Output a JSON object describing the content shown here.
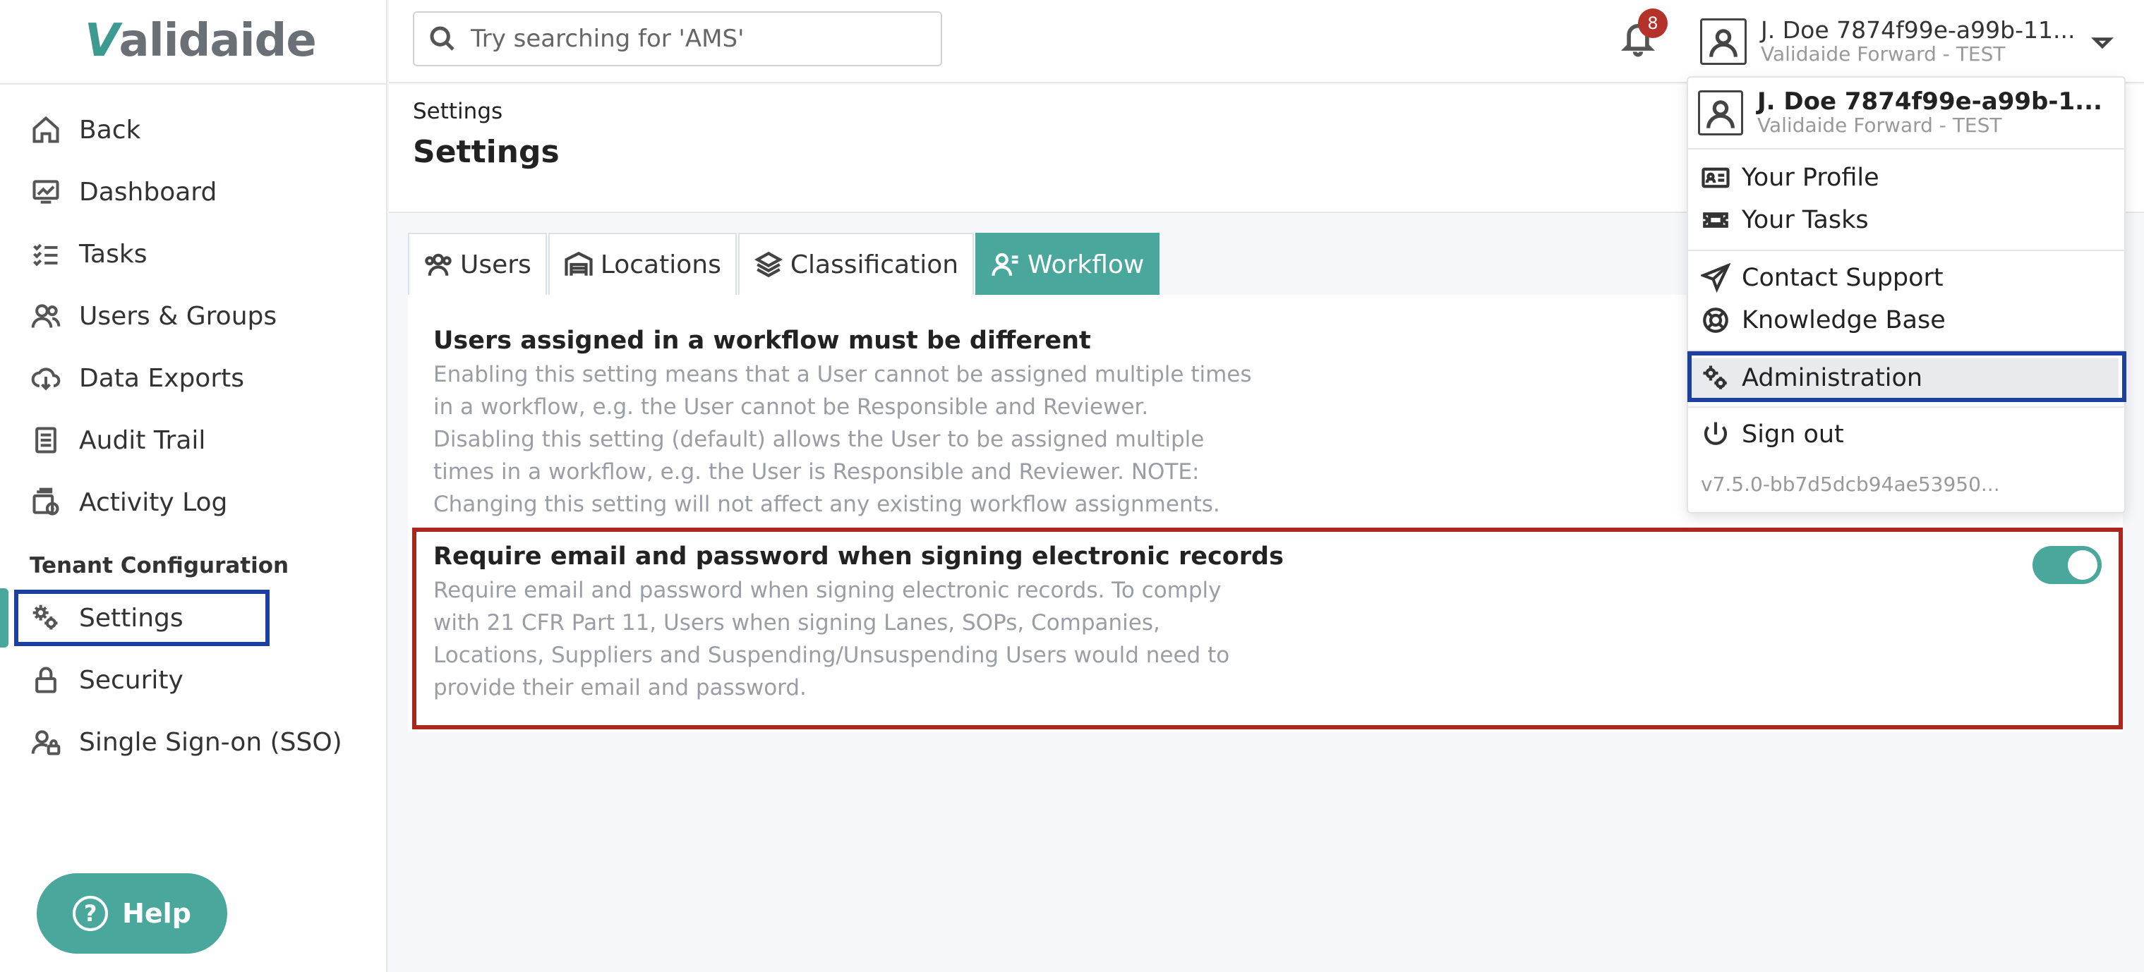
{
  "app": {
    "logo_v": "V",
    "logo_rest": "alidaide"
  },
  "sidebar": {
    "items": [
      {
        "label": "Back"
      },
      {
        "label": "Dashboard"
      },
      {
        "label": "Tasks"
      },
      {
        "label": "Users & Groups"
      },
      {
        "label": "Data Exports"
      },
      {
        "label": "Audit Trail"
      },
      {
        "label": "Activity Log"
      }
    ],
    "section_label": "Tenant Configuration",
    "config_items": [
      {
        "label": "Settings"
      },
      {
        "label": "Security"
      },
      {
        "label": "Single Sign-on (SSO)"
      }
    ],
    "help_label": "Help"
  },
  "topbar": {
    "search_placeholder": "Try searching for 'AMS'",
    "notification_count": "8",
    "user_name": "J. Doe 7874f99e-a99b-11...",
    "user_org": "Validaide Forward - TEST"
  },
  "header": {
    "breadcrumb": "Settings",
    "title": "Settings"
  },
  "tabs": [
    {
      "label": "Users"
    },
    {
      "label": "Locations"
    },
    {
      "label": "Classification"
    },
    {
      "label": "Workflow"
    }
  ],
  "settings": [
    {
      "title": "Users assigned in a workflow must be different",
      "description": "Enabling this setting means that a User cannot be assigned multiple times in a workflow, e.g. the User cannot be Responsible and Reviewer. Disabling this setting (default) allows the User to be assigned multiple times in a workflow, e.g. the User is Responsible and Reviewer. NOTE: Changing this setting will not affect any existing workflow assignments."
    },
    {
      "title": "Require email and password when signing electronic records",
      "description": "Require email and password when signing electronic records. To comply with 21 CFR Part 11, Users when signing Lanes, SOPs, Companies, Locations, Suppliers and Suspending/Unsuspending Users would need to provide their email and password.",
      "enabled": true
    }
  ],
  "dropdown": {
    "user_name": "J. Doe 7874f99e-a99b-1...",
    "user_org": "Validaide Forward - TEST",
    "items": [
      {
        "label": "Your Profile"
      },
      {
        "label": "Your Tasks"
      },
      {
        "label": "Contact Support"
      },
      {
        "label": "Knowledge Base"
      },
      {
        "label": "Administration"
      },
      {
        "label": "Sign out"
      }
    ],
    "version": "v7.5.0-bb7d5dcb94ae53950..."
  },
  "colors": {
    "accent": "#4aa79b",
    "highlight_blue": "#1d3fa0",
    "highlight_red": "#a8281e",
    "badge": "#b5322a"
  }
}
